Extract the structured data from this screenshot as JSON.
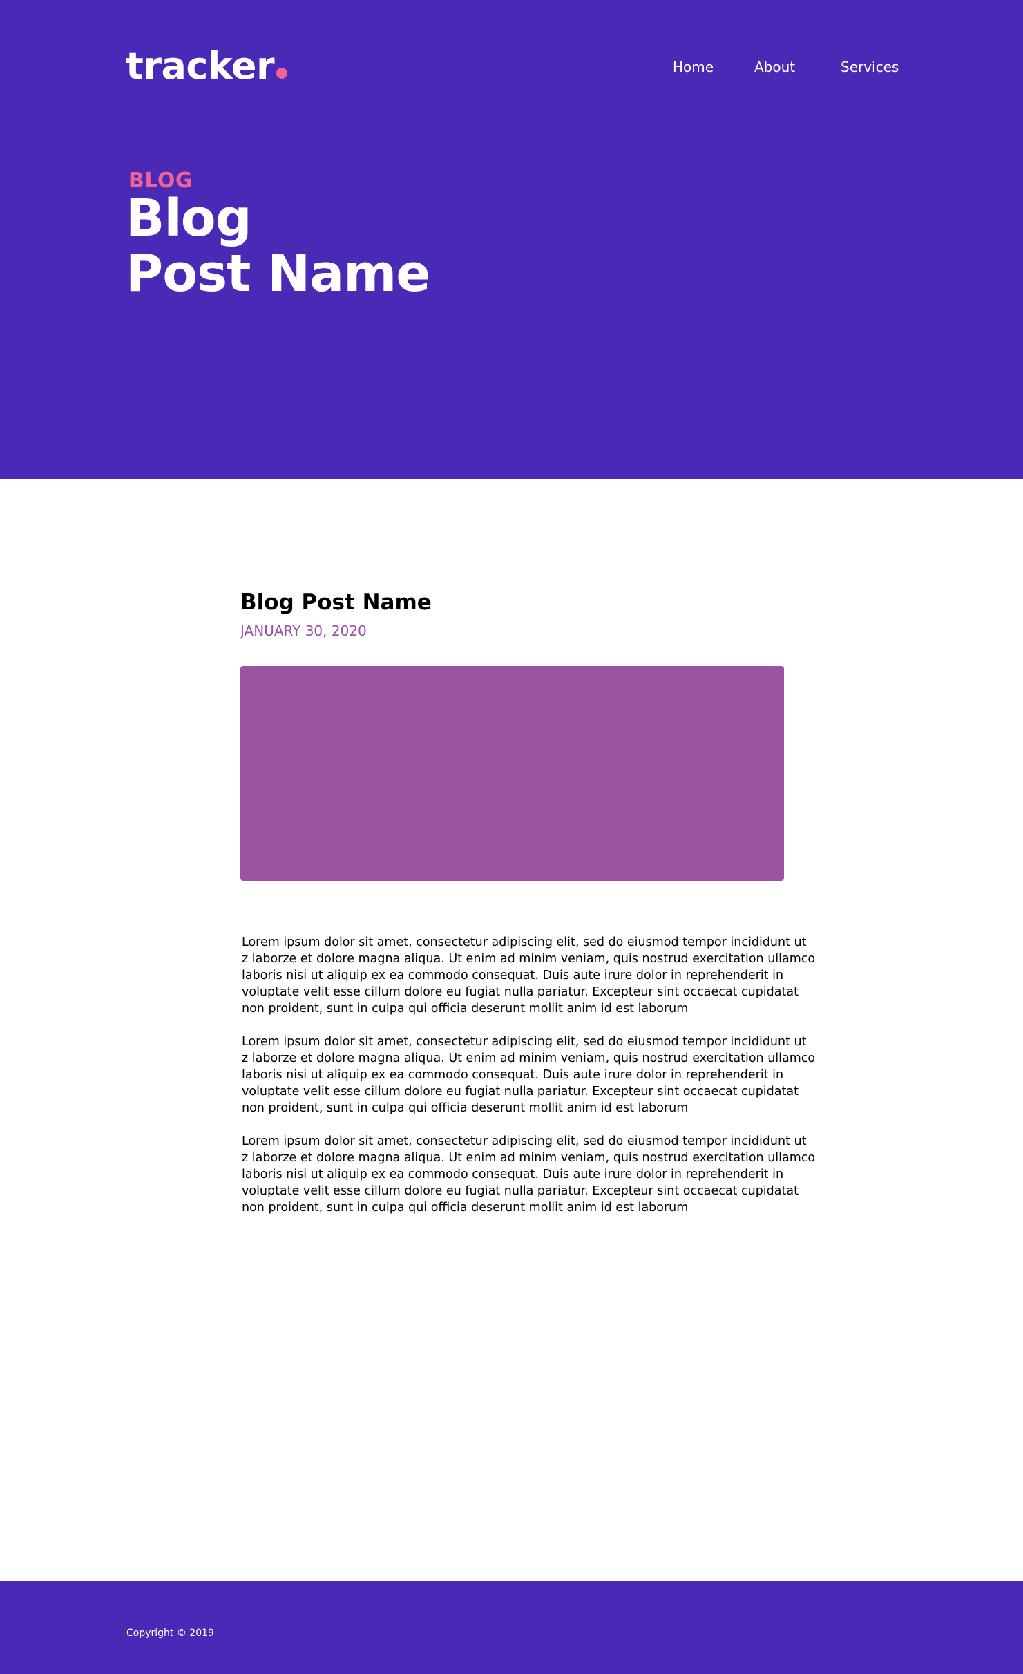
{
  "brand": {
    "name": "tracker",
    "dot_color": "#f06292"
  },
  "nav": {
    "items": [
      {
        "label": "Home"
      },
      {
        "label": "About"
      },
      {
        "label": "Services"
      }
    ]
  },
  "hero": {
    "eyebrow": "BLOG",
    "eyebrow_color": "#f06292",
    "title_line1": "Blog",
    "title_line2": "Post Name",
    "background": "#4a29b6"
  },
  "post": {
    "title": "Blog Post Name",
    "date": "JANUARY 30, 2020",
    "date_color": "#9b51a3",
    "image_color": "#9b55a0",
    "paragraphs": [
      [
        "Lorem ipsum dolor sit amet, consectetur adipiscing elit, sed do eiusmod tempor incididunt ut",
        "z laborze et dolore magna aliqua. Ut enim ad minim veniam, quis nostrud exercitation ullamco",
        " laboris nisi ut aliquip ex ea commodo consequat. Duis aute irure dolor in reprehenderit in",
        "voluptate velit esse cillum dolore eu fugiat nulla pariatur. Excepteur sint occaecat cupidatat",
        "non proident, sunt in culpa qui officia deserunt mollit anim id est laborum"
      ],
      [
        "Lorem ipsum dolor sit amet, consectetur adipiscing elit, sed do eiusmod tempor incididunt ut",
        "z laborze et dolore magna aliqua. Ut enim ad minim veniam, quis nostrud exercitation ullamco",
        " laboris nisi ut aliquip ex ea commodo consequat. Duis aute irure dolor in reprehenderit in",
        "voluptate velit esse cillum dolore eu fugiat nulla pariatur. Excepteur sint occaecat cupidatat",
        "non proident, sunt in culpa qui officia deserunt mollit anim id est laborum"
      ],
      [
        "Lorem ipsum dolor sit amet, consectetur adipiscing elit, sed do eiusmod tempor incididunt ut",
        "z laborze et dolore magna aliqua. Ut enim ad minim veniam, quis nostrud exercitation ullamco",
        " laboris nisi ut aliquip ex ea commodo consequat. Duis aute irure dolor in reprehenderit in",
        "voluptate velit esse cillum dolore eu fugiat nulla pariatur. Excepteur sint occaecat cupidatat",
        "non proident, sunt in culpa qui officia deserunt mollit anim id est laborum"
      ]
    ]
  },
  "footer": {
    "copyright": "Copyright © 2019"
  }
}
